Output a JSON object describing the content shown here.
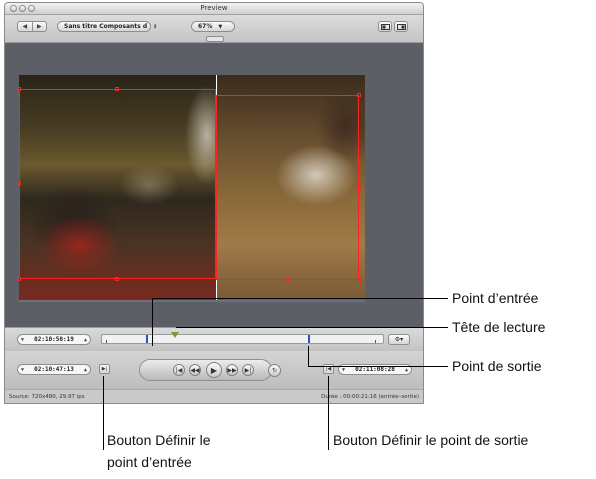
{
  "window": {
    "title": "Preview"
  },
  "toolbar": {
    "back_label": "◀",
    "forward_label": "▶",
    "composition_popup": "Sans titre Composants d",
    "zoom_popup": "67%"
  },
  "timeline": {
    "current_timecode": "02:10:50:19"
  },
  "transport": {
    "in_timecode": "02:10:47:13",
    "out_timecode": "02:11:08:28"
  },
  "status": {
    "source": "Source: 720x480, 29.97 ips",
    "duration": "Durée : 00:00:21:16 (entrée–sortie)"
  },
  "callouts": {
    "in_point": "Point d’entrée",
    "playhead": "Tête de lecture",
    "out_point": "Point de sortie",
    "set_in_line1": "Bouton Définir le",
    "set_in_line2": "point d’entrée",
    "set_out": "Bouton Définir le point de sortie"
  },
  "icons": {
    "set_in": "set-in-point-icon",
    "set_out": "set-out-point-icon",
    "to_start": "go-to-start-icon",
    "prev_frame": "previous-frame-icon",
    "play": "play-icon",
    "next_frame": "next-frame-icon",
    "to_end": "go-to-end-icon",
    "loop": "loop-icon"
  },
  "colors": {
    "mark": "#3050c8",
    "playhead": "#7a9a30",
    "bounds": "#ff2020"
  }
}
